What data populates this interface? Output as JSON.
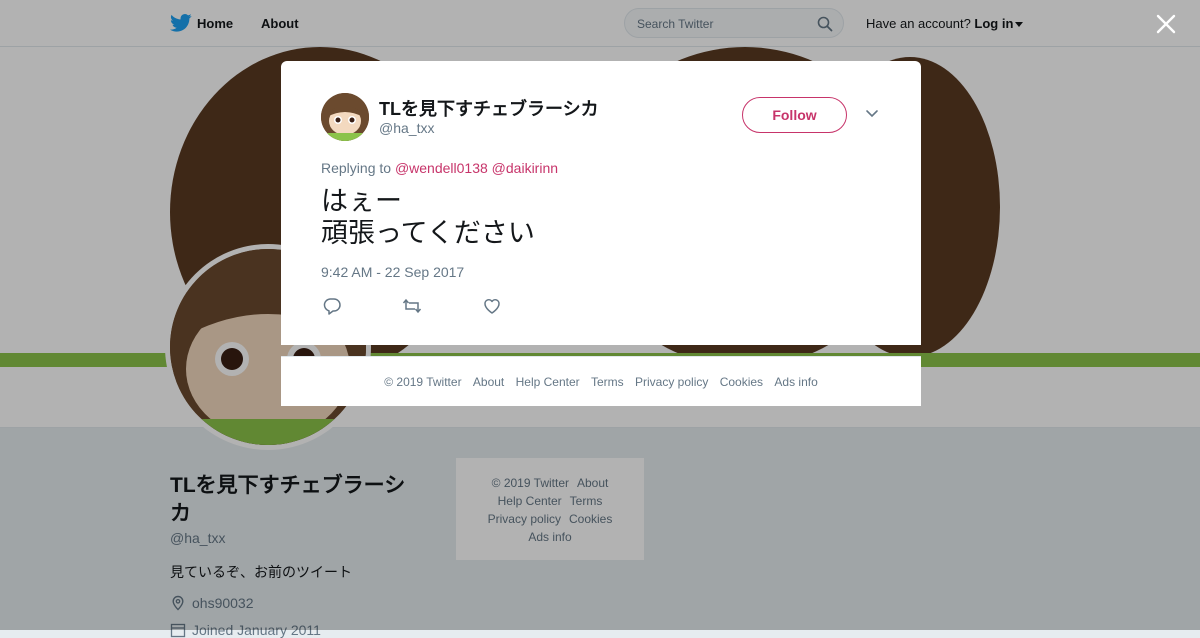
{
  "nav": {
    "home_label": "Home",
    "about_label": "About",
    "search_placeholder": "Search Twitter",
    "account_prompt": "Have an account?",
    "login_label": "Log in"
  },
  "profile": {
    "name": "TLを見下すチェブラーシカ",
    "handle": "@ha_txx",
    "bio": "見ているぞ、お前のツイート",
    "location": "ohs90032",
    "joined": "Joined January 2011"
  },
  "side_footer": {
    "links": [
      "© 2019 Twitter",
      "About",
      "Help Center",
      "Terms",
      "Privacy policy",
      "Cookies",
      "Ads info"
    ]
  },
  "tweet": {
    "author_name": "TLを見下すチェブラーシカ",
    "author_handle": "@ha_txx",
    "follow_label": "Follow",
    "replying_prefix": "Replying to",
    "mention_1": "@wendell0138",
    "mention_2": "@daikirinn",
    "text": "はぇー\n頑張ってください",
    "timestamp": "9:42 AM - 22 Sep 2017"
  },
  "modal_footer": {
    "links": [
      "© 2019 Twitter",
      "About",
      "Help Center",
      "Terms",
      "Privacy policy",
      "Cookies",
      "Ads info"
    ]
  },
  "icons": {
    "logo": "twitter-bird-icon",
    "search": "search-icon",
    "close": "close-icon",
    "reply": "reply-icon",
    "retweet": "retweet-icon",
    "like": "heart-icon",
    "menu": "chevron-down-icon",
    "location": "location-pin-icon",
    "calendar": "calendar-icon"
  },
  "colors": {
    "brand": "#1da1f2",
    "accent": "#c7346a",
    "overlay": "rgba(0,0,0,0.30)"
  }
}
